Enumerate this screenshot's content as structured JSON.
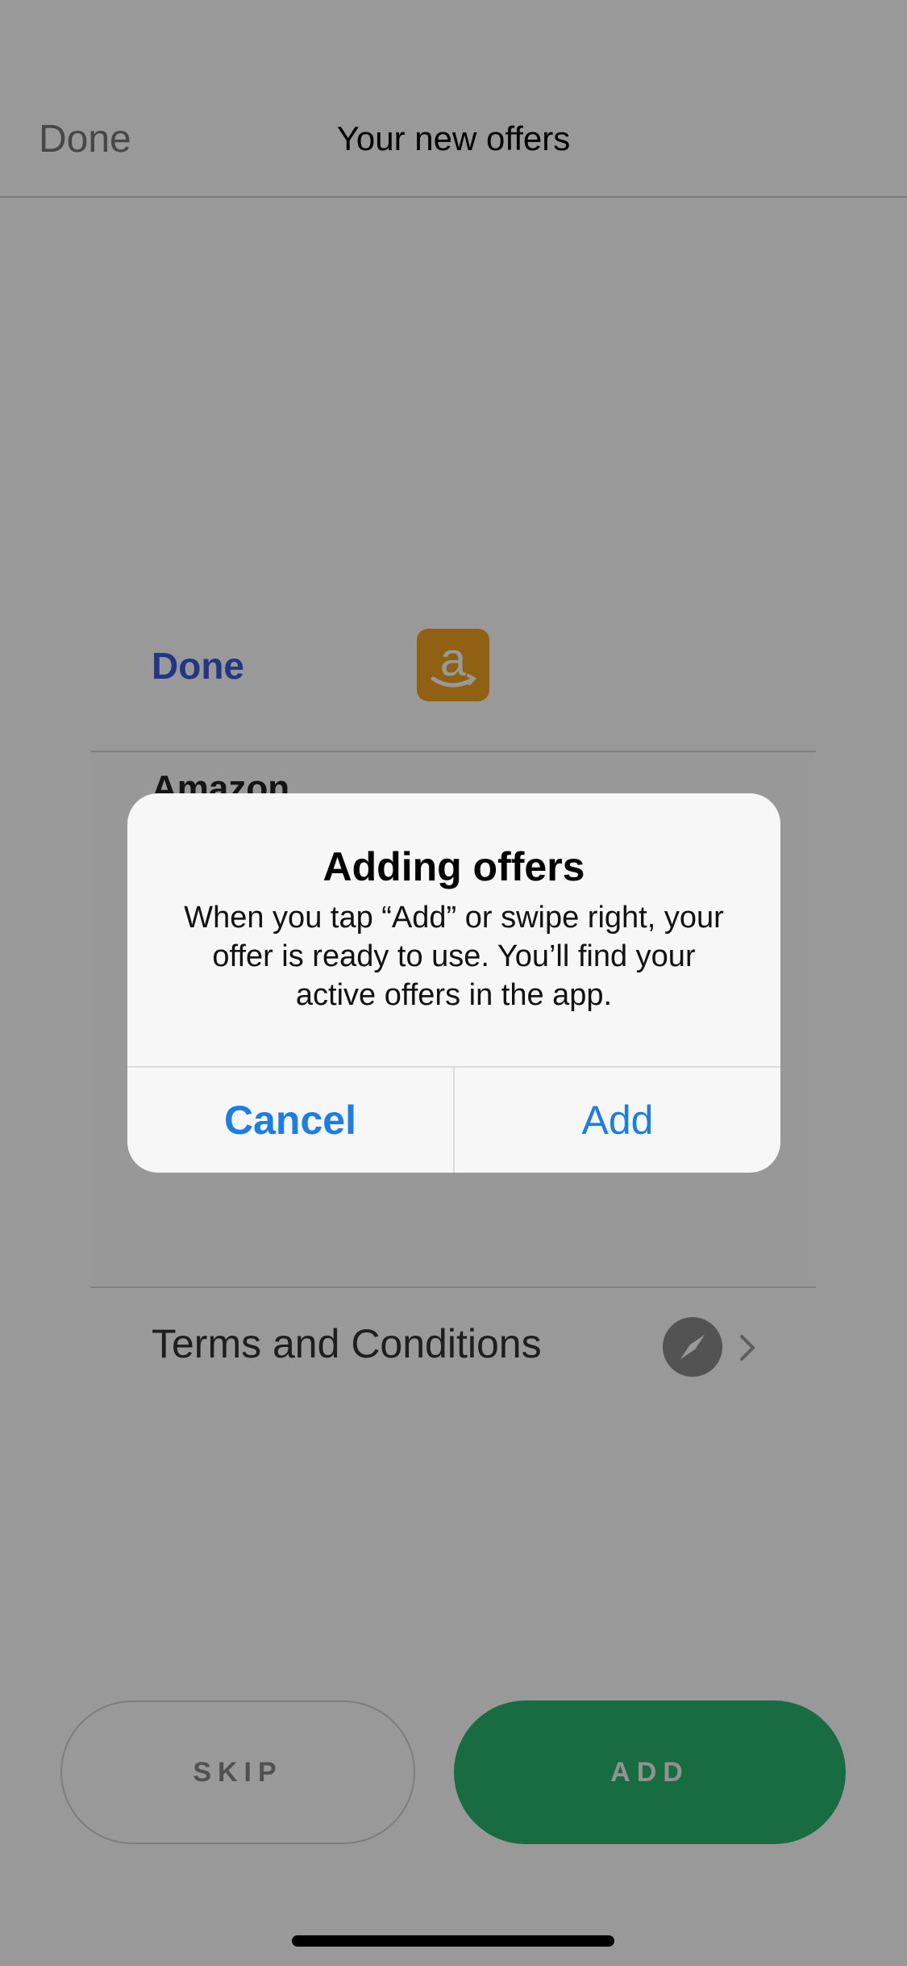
{
  "nav": {
    "done_label": "Done",
    "title": "Your new offers"
  },
  "offer_card": {
    "done_label": "Done",
    "merchant_name": "Amazon",
    "logo_icon": "amazon-logo-icon",
    "logo_color": "#f0a020"
  },
  "terms": {
    "label": "Terms and Conditions",
    "icon": "compass-icon",
    "chevron": "chevron-right-icon"
  },
  "actions": {
    "skip_label": "SKIP",
    "add_label": "ADD",
    "add_color": "#28b56e"
  },
  "alert": {
    "title": "Adding offers",
    "message": "When you tap “Add” or swipe right, your offer is ready to use. You’ll find your active offers in the app.",
    "cancel_label": "Cancel",
    "add_label": "Add",
    "button_color": "#1a7ee6"
  }
}
